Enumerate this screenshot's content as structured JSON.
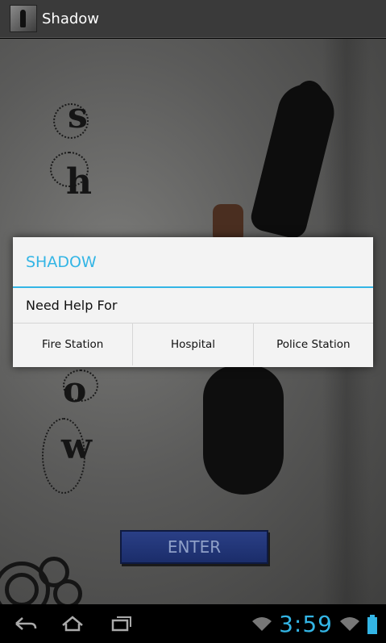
{
  "action_bar": {
    "title": "Shadow",
    "icon": "app-shadow-icon"
  },
  "background": {
    "letters": [
      "s",
      "h",
      "o",
      "w"
    ],
    "enter_label": "ENTER"
  },
  "dialog": {
    "title": "SHADOW",
    "message": "Need Help For",
    "buttons": [
      "Fire Station",
      "Hospital",
      "Police Station"
    ],
    "accent_color": "#33b5e5"
  },
  "system_bar": {
    "time": "3:59",
    "icons": [
      "back-icon",
      "home-icon",
      "recent-apps-icon",
      "wifi-icon",
      "signal-icon",
      "battery-icon"
    ]
  }
}
